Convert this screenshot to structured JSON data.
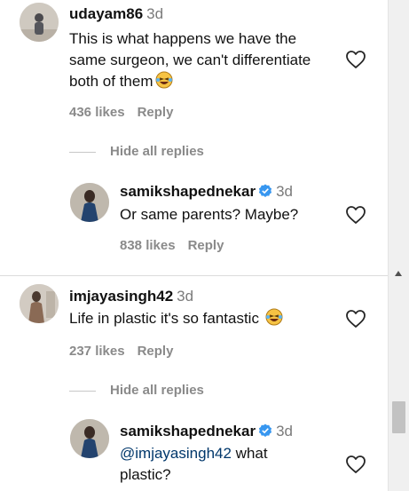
{
  "comments": [
    {
      "username": "udayam86",
      "time": "3d",
      "text": "This is what happens we have the same surgeon, we can't differentiate both of them",
      "likes": "436 likes",
      "reply_label": "Reply",
      "toggle_label": "Hide all replies"
    },
    {
      "username": "imjayasingh42",
      "time": "3d",
      "text": "Life in plastic it's so fantastic",
      "likes": "237 likes",
      "reply_label": "Reply",
      "toggle_label": "Hide all replies"
    }
  ],
  "replies": [
    {
      "username": "samikshapednekar",
      "time": "3d",
      "text": "Or same parents? Maybe?",
      "likes": "838 likes",
      "reply_label": "Reply"
    },
    {
      "username": "samikshapednekar",
      "time": "3d",
      "mention": "@imjayasingh42",
      "text_after_mention": " what",
      "text_line2": "plastic?"
    }
  ],
  "icons": {
    "heart": "heart-outline-icon",
    "verified": "verified-badge-icon",
    "emoji": "laughing-emoji-icon"
  },
  "colors": {
    "verified": "#3897f0",
    "muted_text": "#8a8a8a",
    "mention": "#00376b"
  }
}
